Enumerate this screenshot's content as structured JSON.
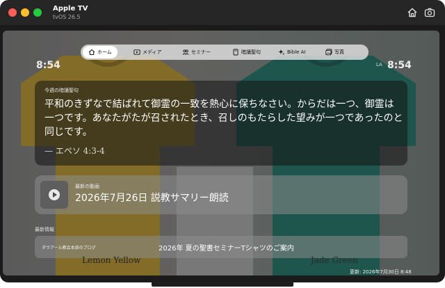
{
  "window": {
    "title": "Apple TV",
    "subtitle": "tvOS 26.5"
  },
  "toolbar": {
    "home_icon": "home-icon",
    "screenshot_icon": "camera-icon"
  },
  "clock": {
    "left": "8:54",
    "right_prefix": "LA",
    "right": "8:54"
  },
  "nav": {
    "items": [
      {
        "label": "ホーム",
        "icon": "house-icon",
        "active": true
      },
      {
        "label": "メディア",
        "icon": "play-rectangle-icon",
        "active": false
      },
      {
        "label": "セミナー",
        "icon": "people-icon",
        "active": false
      },
      {
        "label": "暗誦聖句",
        "icon": "book-icon",
        "active": false
      },
      {
        "label": "Bible AI",
        "icon": "sparkle-icon",
        "active": false
      },
      {
        "label": "写真",
        "icon": "photo-icon",
        "active": false
      }
    ]
  },
  "verse": {
    "label": "今週の暗誦聖句",
    "text": "平和のきずなで結ばれて御霊の一致を熱心に保ちなさい。からだは一つ、御霊は一つです。あなたがたが召されたとき、召しのもたらした望みが一つであったのと同じです。",
    "reference": "— エペソ 4:3-4"
  },
  "video": {
    "label": "最新の動画",
    "title": "2026年7月26日 説教サマリー朗読"
  },
  "news": {
    "heading": "最新情報",
    "source": "ダウアール教会本部のブログ",
    "title": "2026年 夏の聖書セミナーTシャツのご案内"
  },
  "background": {
    "left_label": "Lemon Yellow",
    "right_label": "Jade Green",
    "left_color": "#b8941e",
    "right_color": "#0f6b5a"
  },
  "updated": "更新: 2026年7月30日 8:48",
  "colors": {
    "red": "#ff5f57",
    "yellow": "#febc2e",
    "green": "#28c840"
  }
}
